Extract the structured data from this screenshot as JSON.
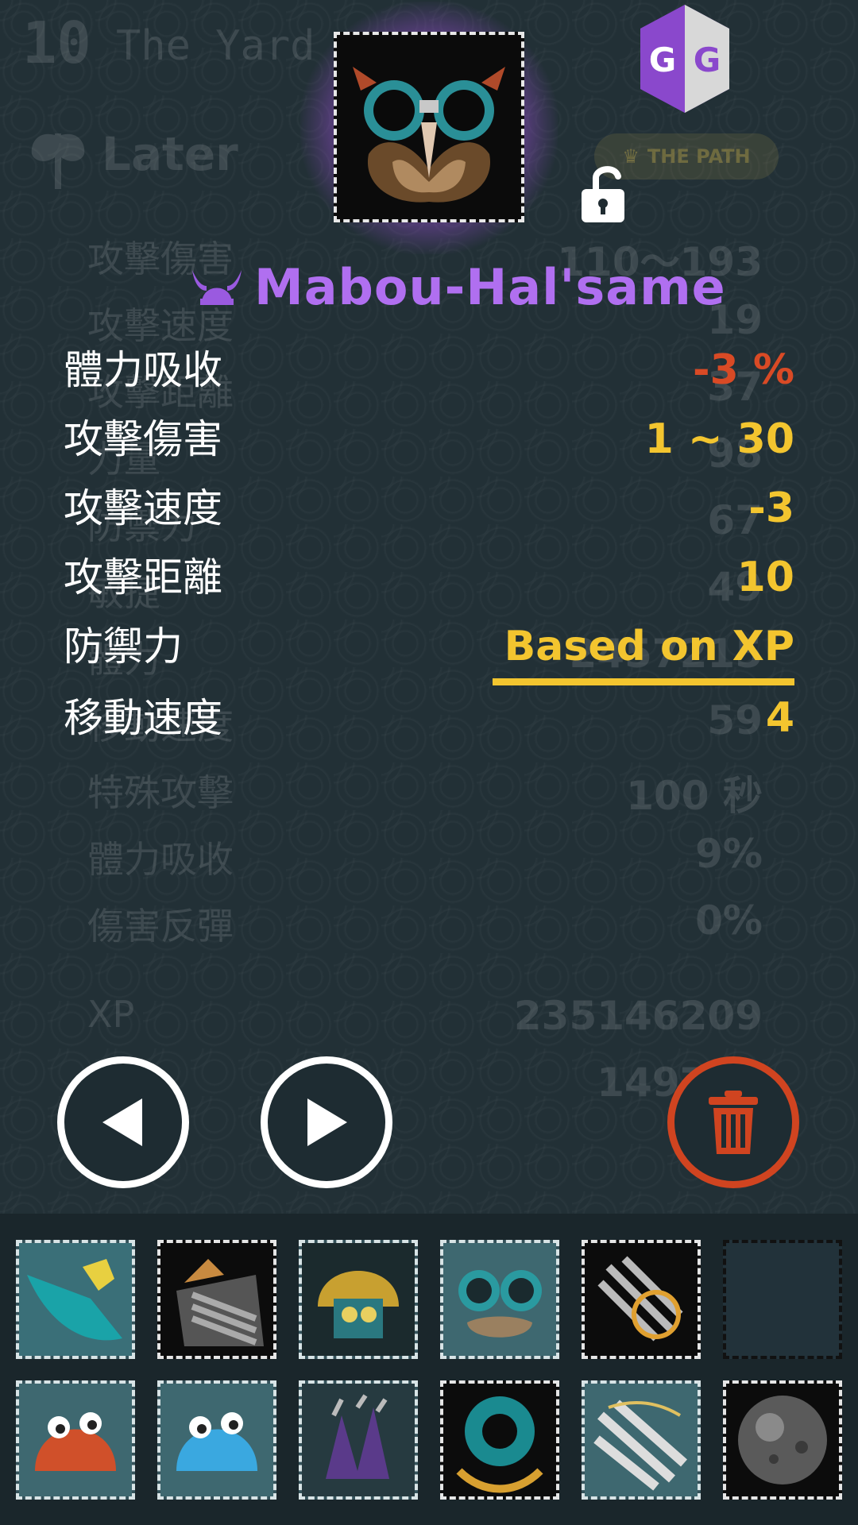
{
  "background": {
    "level_number": "10",
    "level_name": "The Yard",
    "later_label": "Later",
    "path_badge": "THE PATH",
    "ghost_stats": [
      {
        "label": "攻擊傷害",
        "value": "110～193"
      },
      {
        "label": "攻擊速度",
        "value": "19"
      },
      {
        "label": "攻擊距離",
        "value": "37"
      },
      {
        "label": "力量",
        "value": "98"
      },
      {
        "label": "防禦力",
        "value": "67"
      },
      {
        "label": "敏捷",
        "value": "49"
      },
      {
        "label": "體力",
        "value": "2457215"
      },
      {
        "label": "移動速度",
        "value": "59"
      },
      {
        "label": "特殊攻擊",
        "value": "100 秒"
      },
      {
        "label": "體力吸收",
        "value": "9%"
      },
      {
        "label": "傷害反彈",
        "value": "0%"
      },
      {
        "label": "XP",
        "value": "235146209"
      },
      {
        "label": "",
        "value": "149757"
      },
      {
        "label": "",
        "value": "9"
      }
    ]
  },
  "item": {
    "name": "Mabou-Hal'same",
    "rarity_color": "#b06ff0"
  },
  "stats": [
    {
      "label": "體力吸收",
      "value": "-3 %",
      "negative": true
    },
    {
      "label": "攻擊傷害",
      "value": "1 ~ 30",
      "negative": false
    },
    {
      "label": "攻擊速度",
      "value": "-3",
      "negative": false
    },
    {
      "label": "攻擊距離",
      "value": "10",
      "negative": false
    },
    {
      "label": "防禦力",
      "value": "Based on XP",
      "negative": false
    },
    {
      "label": "移動速度",
      "value": "4",
      "negative": false
    }
  ],
  "colors": {
    "stat_positive": "#f3c52f",
    "stat_negative": "#d94a25",
    "delete": "#d04420"
  },
  "buttons": {
    "prev": "prev-arrow-icon",
    "next": "next-arrow-icon",
    "delete": "trash-icon"
  },
  "inventory": [
    {
      "icon": "axe-blade-icon",
      "style": "light"
    },
    {
      "icon": "claw-gauntlet-icon",
      "style": "dark"
    },
    {
      "icon": "gold-helmet-icon",
      "style": "light"
    },
    {
      "icon": "goggle-mask-icon",
      "style": "light"
    },
    {
      "icon": "ring-gauntlet-icon",
      "style": "dark"
    },
    {
      "icon": "empty-slot",
      "style": "empty"
    },
    {
      "icon": "red-slime-icon",
      "style": "light"
    },
    {
      "icon": "blue-slime-icon",
      "style": "light"
    },
    {
      "icon": "purple-claw-icon",
      "style": "light"
    },
    {
      "icon": "teal-ring-icon",
      "style": "dark"
    },
    {
      "icon": "claw-scratch-icon",
      "style": "light"
    },
    {
      "icon": "iron-ball-icon",
      "style": "dark"
    }
  ]
}
